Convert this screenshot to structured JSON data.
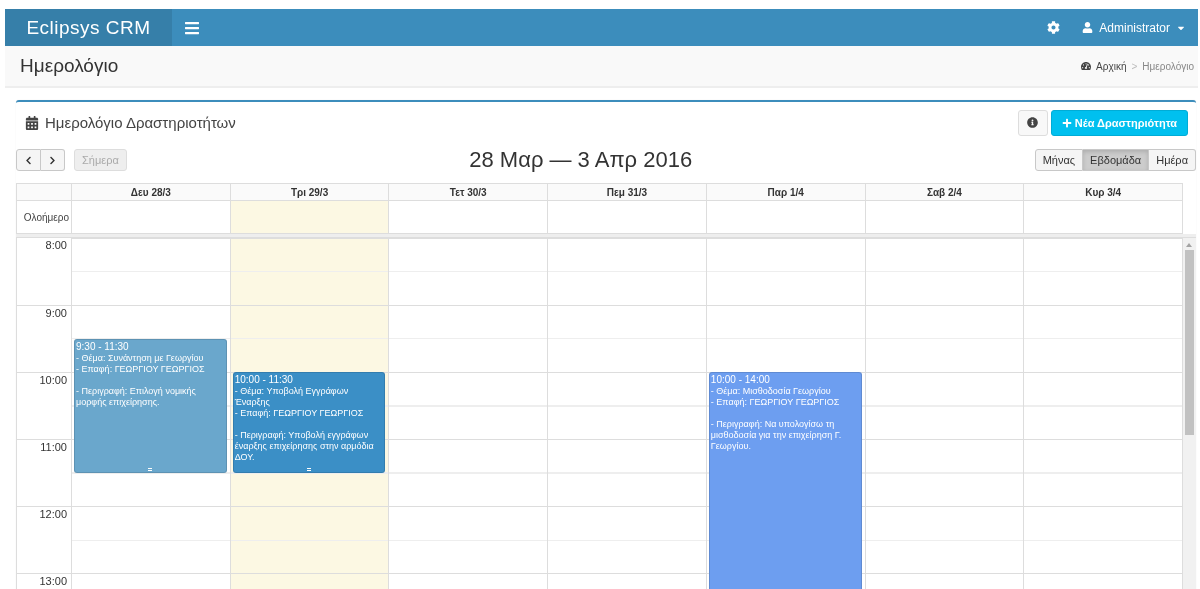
{
  "navbar": {
    "brand": "Eclipsys CRM",
    "user": "Administrator"
  },
  "page": {
    "title": "Ημερολόγιο",
    "breadcrumb_separator": ">",
    "breadcrumb": [
      {
        "label": "Αρχική",
        "selected": false
      },
      {
        "label": "Ημερολόγιο",
        "selected": true
      }
    ]
  },
  "panel": {
    "title": "Ημερολόγιο Δραστηριοτήτων",
    "new_button": "Νέα Δραστηριότητα"
  },
  "toolbar": {
    "today": "Σήμερα",
    "range": "28 Μαρ — 3 Απρ 2016",
    "views": [
      {
        "label": "Μήνας",
        "selected": false
      },
      {
        "label": "Εβδομάδα",
        "selected": true
      },
      {
        "label": "Ημέρα",
        "selected": false
      }
    ]
  },
  "allday_label": "Ολοήμερο",
  "hours": [
    "8:00",
    "9:00",
    "10:00",
    "11:00",
    "12:00",
    "13:00"
  ],
  "days": [
    {
      "label": "Δευ 28/3",
      "today": false,
      "events": [
        {
          "time": "9:30 - 11:30",
          "subject": "- Θέμα: Συνάντηση με Γεωργίου",
          "contact": "- Επαφή: ΓΕΩΡΓΙΟΥ ΓΕΩΡΓΙΟΣ",
          "description": "- Περιγραφή: Επιλογή νομικής μορφής επιχείρησης.",
          "color": "#6aa7cc"
        }
      ]
    },
    {
      "label": "Τρι 29/3",
      "today": true,
      "events": [
        {
          "time": "10:00 - 11:30",
          "subject": "- Θέμα: Υποβολή Εγγράφων Έναρξης",
          "contact": "- Επαφή: ΓΕΩΡΓΙΟΥ ΓΕΩΡΓΙΟΣ",
          "description": "- Περιγραφή: Υποβολή εγγράφων έναρξης επιχείρησης στην αρμόδια ΔΟΥ.",
          "color": "#3b8fc6"
        }
      ]
    },
    {
      "label": "Τετ 30/3",
      "today": false
    },
    {
      "label": "Πεμ 31/3",
      "today": false
    },
    {
      "label": "Παρ 1/4",
      "today": false,
      "events": [
        {
          "time": "10:00 - 14:00",
          "subject": "- Θέμα: Μισθοδοσία Γεωργίου",
          "contact": "- Επαφή: ΓΕΩΡΓΙΟΥ ΓΕΩΡΓΙΟΣ",
          "description": "- Περιγραφή: Να υπολογίσω τη μισθοδοσία για την επιχείρηση Γ. Γεωργίου.",
          "color": "#6d9ef0"
        }
      ]
    },
    {
      "label": "Σαβ 2/4",
      "today": false
    },
    {
      "label": "Κυρ 3/4",
      "today": false
    }
  ]
}
